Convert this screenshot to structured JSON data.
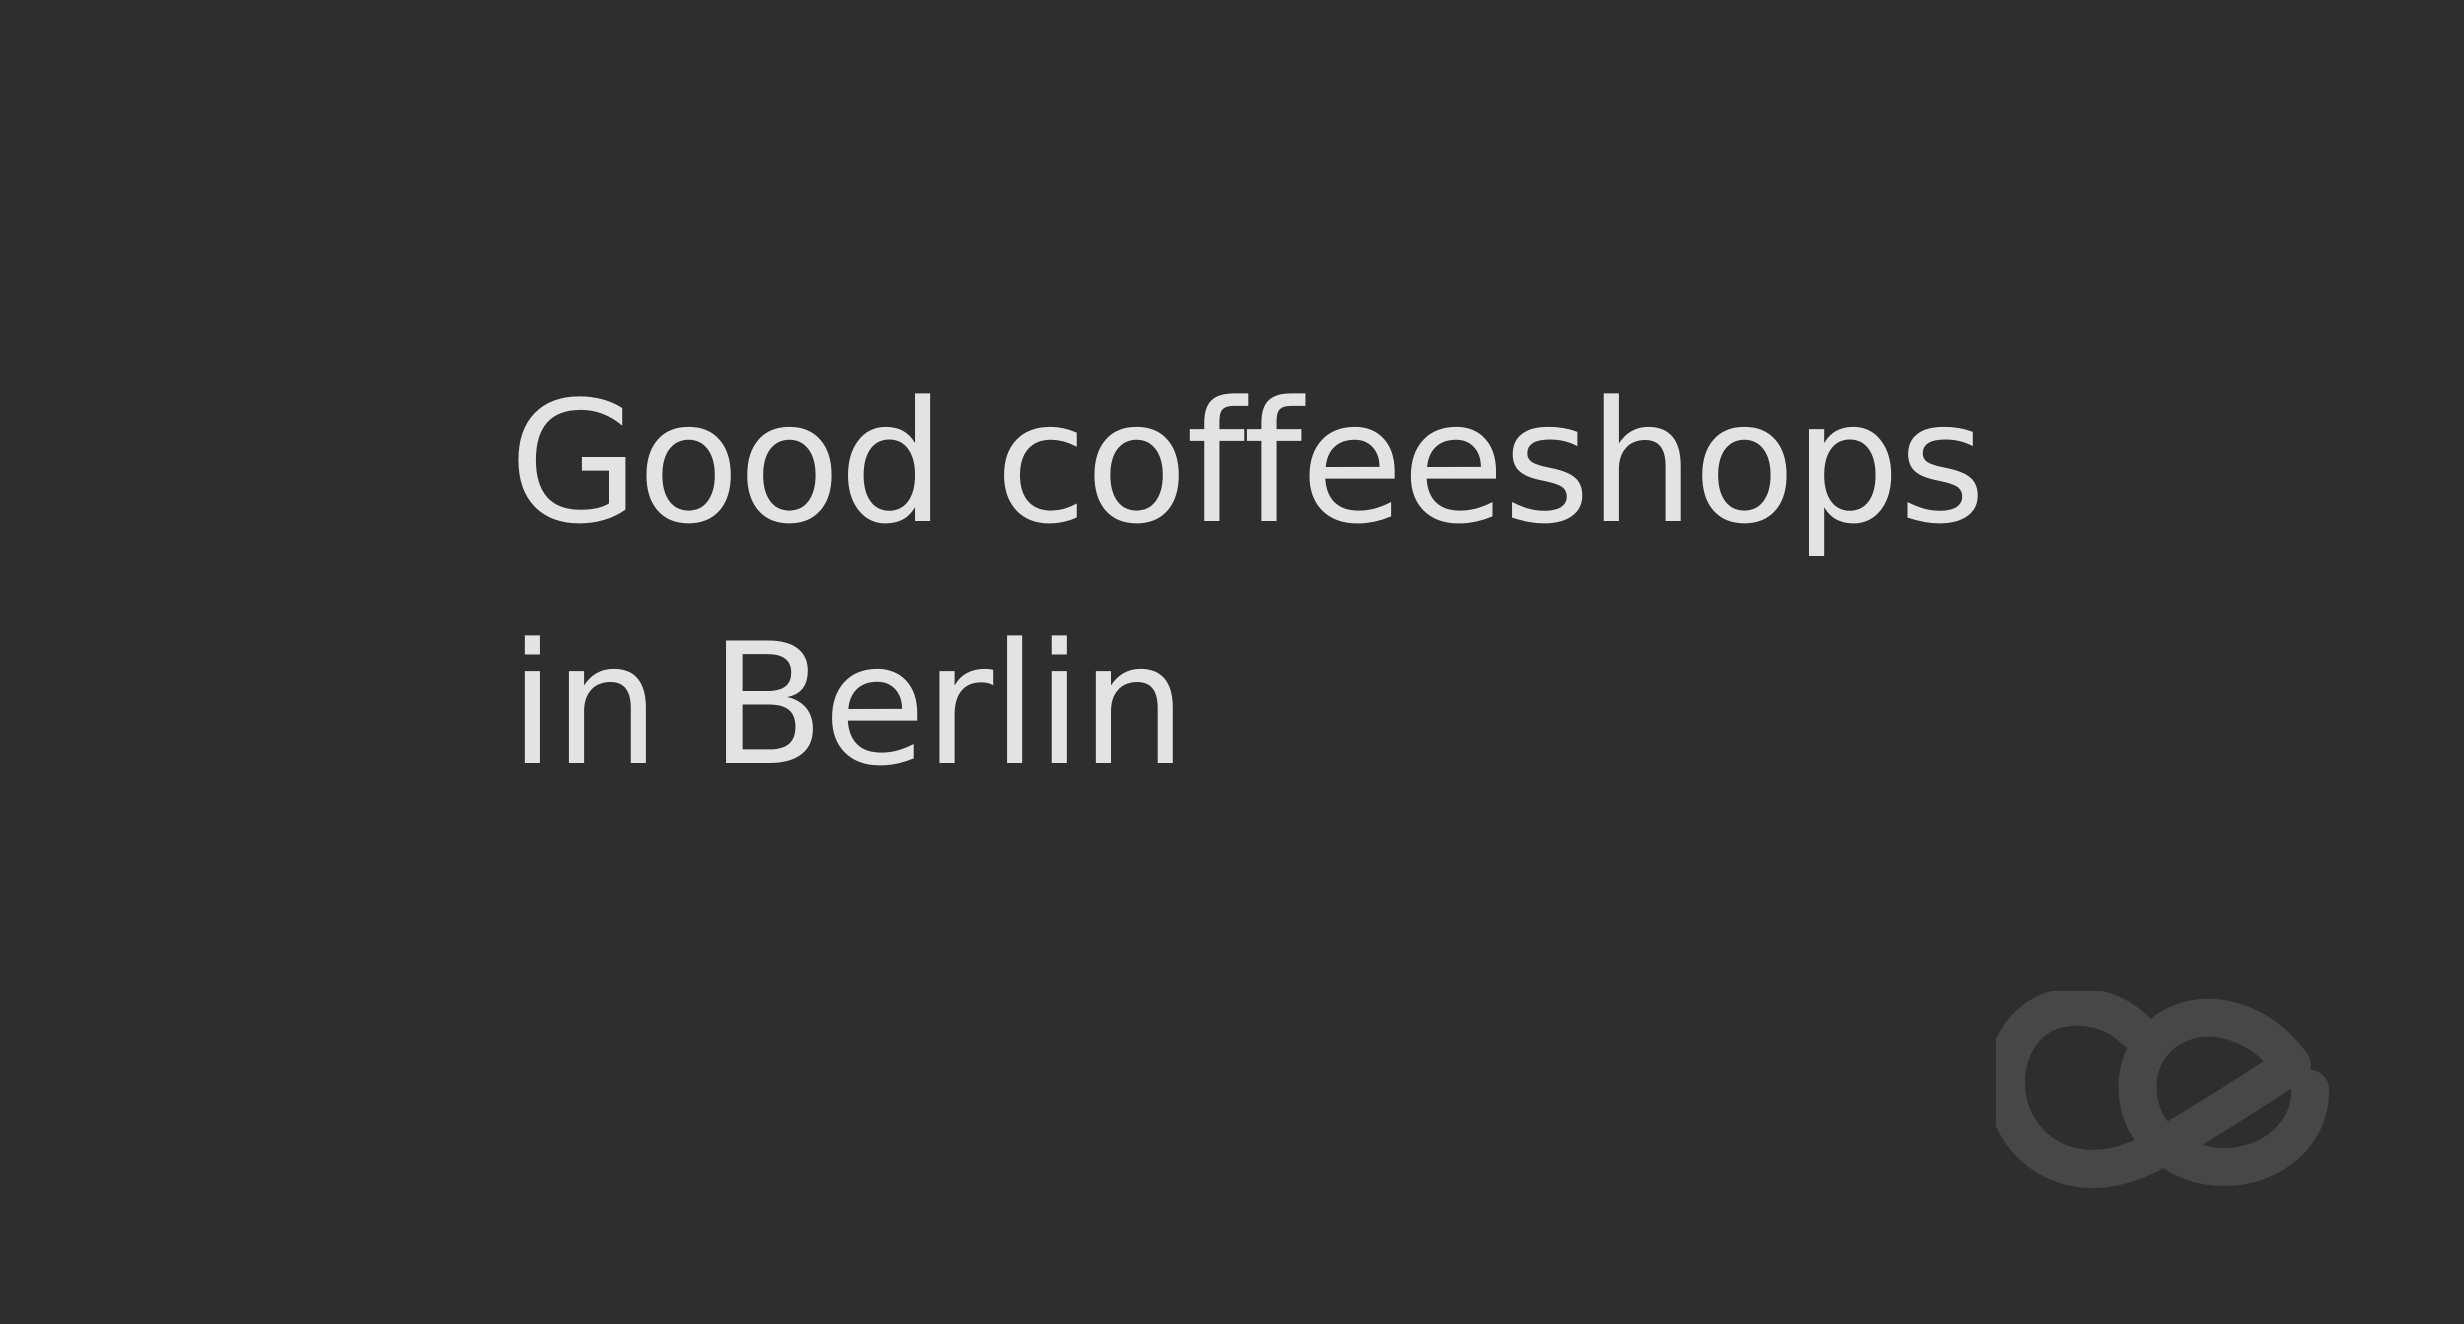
{
  "headline": {
    "line1": "Good coffeeshops",
    "line2": "in Berlin"
  },
  "logo": {
    "icon": "ce-logo-icon"
  },
  "colors": {
    "background": "#2e2e2e",
    "headline_text": "#e3e3e3",
    "logo": "#474747"
  }
}
